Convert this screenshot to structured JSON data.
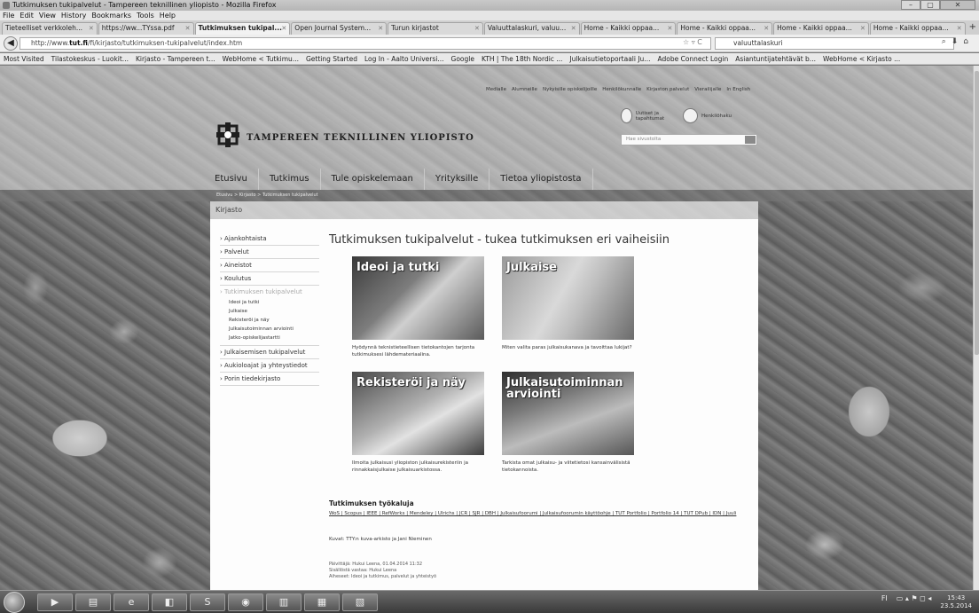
{
  "window": {
    "title": "Tutkimuksen tukipalvelut - Tampereen teknillinen yliopisto - Mozilla Firefox",
    "controls": [
      "–",
      "▢",
      "✕"
    ]
  },
  "menu": [
    "File",
    "Edit",
    "View",
    "History",
    "Bookmarks",
    "Tools",
    "Help"
  ],
  "tabs": [
    {
      "label": "Tieteelliset verkkoleh...",
      "active": false
    },
    {
      "label": "https://ww...TYssa.pdf",
      "active": false
    },
    {
      "label": "Tutkimuksen tukipal...",
      "active": true
    },
    {
      "label": "Open Journal System...",
      "active": false
    },
    {
      "label": "Turun kirjastot",
      "active": false
    },
    {
      "label": "Valuuttalaskuri, valuu...",
      "active": false
    },
    {
      "label": "Home - Kaikki oppaa...",
      "active": false
    },
    {
      "label": "Home - Kaikki oppaa...",
      "active": false
    },
    {
      "label": "Home - Kaikki oppaa...",
      "active": false
    },
    {
      "label": "Home - Kaikki oppaa...",
      "active": false
    }
  ],
  "navbar": {
    "url_prefix": "http://www.",
    "url_domain": "tut.fi",
    "url_path": "/fi/kirjasto/tutkimuksen-tukipalvelut/index.htm",
    "search_value": "valuuttalaskuri"
  },
  "bookmarks": [
    "Most Visited",
    "Tilastokeskus - Luokit...",
    "Kirjasto - Tampereen t...",
    "WebHome < Tutkimu...",
    "Getting Started",
    "Log In - Aalto Universi...",
    "Google",
    "KTH | The 18th Nordic ...",
    "Julkaisutietoportaali Ju...",
    "Adobe Connect Login",
    "Asiantuntijatehtävät b...",
    "WebHome < Kirjasto ..."
  ],
  "site": {
    "toplinks": [
      "Medialle",
      "Alumneille",
      "Nykyisille opiskelijoille",
      "Henkilökunnalle",
      "Kirjaston palvelut",
      "Vierailijalle",
      "In English"
    ],
    "logo_text": "TAMPEREEN TEKNILLINEN YLIOPISTO",
    "quick": [
      "Uutiset ja tapahtumat",
      "Henkilöhaku"
    ],
    "search_placeholder": "Hae sivustolta",
    "mainnav": [
      "Etusivu",
      "Tutkimus",
      "Tule opiskelemaan",
      "Yrityksille",
      "Tietoa yliopistosta"
    ],
    "breadcrumb": "Etusivu > Kirjasto > Tutkimuksen tukipalvelut",
    "section": "Kirjasto"
  },
  "sidebar": {
    "items": [
      "Ajankohtaista",
      "Palvelut",
      "Aineistot",
      "Koulutus"
    ],
    "current": "Tutkimuksen tukipalvelut",
    "subitems": [
      "Ideoi ja tutki",
      "Julkaise",
      "Rekisteröi ja näy",
      "Julkaisutoiminnan arviointi",
      "Jatko-opiskelijastartti"
    ],
    "items_after": [
      "Julkaisemisen tukipalvelut",
      "Aukioloajat ja yhteystiedot",
      "Porin tiedekirjasto"
    ]
  },
  "main": {
    "title": "Tutkimuksen tukipalvelut - tukea tutkimuksen eri vaiheisiin",
    "cards": [
      {
        "label": "Ideoi ja tutki",
        "caption": "Hyödynnä teknistieteellisen tietokantojen tarjonta tutkimuksesi lähdemateriaalina."
      },
      {
        "label": "Julkaise",
        "caption": "Miten valita paras julkaisukanava ja tavoittaa lukijat?"
      },
      {
        "label": "Rekisteröi ja näy",
        "caption": "Ilmoita julkaisusi yliopiston julkaisurekisteriin ja rinnakkaisjulkaise julkaisuarkistossa."
      },
      {
        "label": "Julkaisutoiminnan arviointi",
        "caption": "Tarkista omat julkaisu- ja viitetietosi kansainvälisistä tietokannoista."
      }
    ],
    "tools_title": "Tutkimuksen työkaluja",
    "tools_links": "WoS | Scopus | IEEE | RefWorks | Mendeley | Ulrichs | JCR | SJR | DBH | Julkaisufoorumi | Julkaisufoorumin käyttöohje | TUT Portfolio | Portfolio 14 | TUT DPub | IDN | Juuli",
    "credit": "Kuvat: TTY:n kuva-arkisto ja Jani Nieminen",
    "footer": [
      "Päivittäjä: Hukui Leena, 01.04.2014 11:32",
      "Sisällöstä vastaa: Hukui Leena",
      "Aiheseet: Ideoi ja tutkimus, palvelut ja yhteistyö"
    ]
  },
  "taskbar": {
    "items": [
      "▶",
      "▤",
      "e",
      "◧",
      "S",
      "◉",
      "▥",
      "▦",
      "▧"
    ],
    "tray": "FI",
    "time": "15:43",
    "date": "23.5.2014"
  }
}
